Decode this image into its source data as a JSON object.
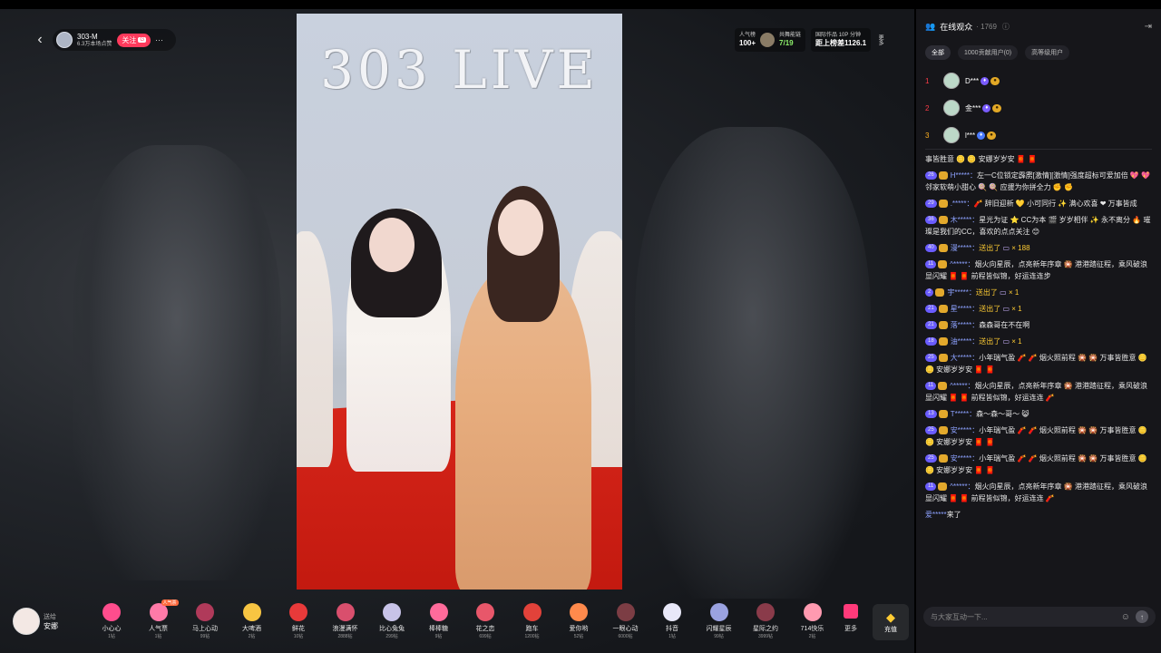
{
  "anchor": {
    "name": "303-M",
    "sub": "6.3万本场点赞",
    "follow": "关注",
    "follow_badge": "G",
    "more": "···"
  },
  "top_stats": {
    "popularity_label": "人气榜",
    "popularity_val": "100+",
    "rank_label": "共舞能链",
    "rank_val": "7/19",
    "hour_label": "国际作品 10P 分钟",
    "hour_val": "距上榜差1126.1",
    "side_label": "更多"
  },
  "video": {
    "logo": "303 LIVE"
  },
  "gift_user": {
    "to": "送给",
    "name": "安娜"
  },
  "gifts": [
    {
      "name": "小心心",
      "price": "1钻",
      "color": "#ff4d8d"
    },
    {
      "name": "人气票",
      "price": "1钻",
      "color": "#ff7aa8",
      "tag": "人气票"
    },
    {
      "name": "马上心动",
      "price": "99钻",
      "color": "#b03a5a"
    },
    {
      "name": "大啤酒",
      "price": "2钻",
      "color": "#f7c542"
    },
    {
      "name": "鲜花",
      "price": "10钻",
      "color": "#e83a3a"
    },
    {
      "name": "浪漫满怀",
      "price": "2888钻",
      "color": "#d94f6d"
    },
    {
      "name": "比心兔兔",
      "price": "299钻",
      "color": "#c8c3e8"
    },
    {
      "name": "棒棒糖",
      "price": "9钻",
      "color": "#ff6b9b"
    },
    {
      "name": "花之恋",
      "price": "699钻",
      "color": "#e8576a"
    },
    {
      "name": "跑车",
      "price": "1200钻",
      "color": "#e2423a"
    },
    {
      "name": "爱你哟",
      "price": "52钻",
      "color": "#ff8a4c"
    },
    {
      "name": "一眼心动",
      "price": "6000钻",
      "color": "#7c3d44"
    },
    {
      "name": "抖音",
      "price": "1钻",
      "color": "#e8e8f8"
    },
    {
      "name": "闪耀星辰",
      "price": "99钻",
      "color": "#9aa2e0"
    },
    {
      "name": "星际之约",
      "price": "3999钻",
      "color": "#8a3b4a"
    },
    {
      "name": "714快乐",
      "price": "2钻",
      "color": "#ff9ab0"
    }
  ],
  "gift_more": "更多",
  "recharge": "充值",
  "panel": {
    "title": "在线观众",
    "count": "· 1769",
    "info": "ⓘ",
    "collapse": "⇥",
    "tabs": [
      "全部",
      "1000贡献用户(0)",
      "高等级用户"
    ],
    "ranks": [
      {
        "num": "1",
        "name": "D***"
      },
      {
        "num": "2",
        "name": "金***"
      },
      {
        "num": "3",
        "name": "l***"
      }
    ],
    "messages": [
      {
        "lv": "",
        "user": "",
        "text": "事皆胜意 🪙 🪙 安娜岁岁安 🧧 🧧"
      },
      {
        "lv": "26",
        "user": "H*****：",
        "text": "左一C位锁定霹雳[激情][激情]强度超标可爱加倍 💖 💖 邻家软萌小甜心 🍭 🍭 应援为你拼全力 ✊ ✊"
      },
      {
        "lv": "29",
        "user": ".*****：",
        "text": "🧨 辞旧迎新 💛 小可同行 ✨ 满心欢喜 ❤ 万事皆成"
      },
      {
        "lv": "36",
        "user": "木*****：",
        "text": "星光为证 ⭐ CC为本 🎬 岁岁相伴 ✨ 永不离分 🔥 璀璨是我们的CC，喜欢的点点关注 😊"
      },
      {
        "lv": "40",
        "user": "漫*****：",
        "gift": "送出了",
        "text": "",
        "count": "× 188"
      },
      {
        "lv": "11",
        "user": "^*****：",
        "text": "烟火向星辰，点亮新年序章 🎇 港港踏征程，乘风破浪显闪耀 🧧 🧧 前程皆似锦，好运连连步"
      },
      {
        "lv": "2",
        "user": "宇*****：",
        "gift": "送出了",
        "text": "",
        "count": "× 1"
      },
      {
        "lv": "21",
        "user": "星*****：",
        "gift": "送出了",
        "text": "",
        "count": "× 1"
      },
      {
        "lv": "21",
        "user": "落*****：",
        "text": "森森哥在不在啊"
      },
      {
        "lv": "18",
        "user": "油*****：",
        "gift": "送出了",
        "text": "",
        "count": "× 1"
      },
      {
        "lv": "25",
        "user": "大*****：",
        "text": "小年瑞气盈 🧨 🧨 烟火照前程 🎇 🎇 万事皆胜意 🪙 🪙 安娜岁岁安 🧧 🧧"
      },
      {
        "lv": "11",
        "user": "^*****：",
        "text": "烟火向星辰，点亮新年序章 🎇 港港踏征程，乘风破浪显闪耀 🧧 🧧 前程皆似锦，好运连连 🧨"
      },
      {
        "lv": "13",
        "user": "T*****：",
        "text": "森～森～哥～ 😸"
      },
      {
        "lv": "25",
        "user": "安*****：",
        "text": "小年瑞气盈 🧨 🧨 烟火照前程 🎇 🎇 万事皆胜意 🪙 🪙 安娜岁岁安 🧧 🧧"
      },
      {
        "lv": "25",
        "user": "安*****：",
        "text": "小年瑞气盈 🧨 🧨 烟火照前程 🎇 🎇 万事皆胜意 🪙 🪙 安娜岁岁安 🧧 🧧"
      },
      {
        "lv": "11",
        "user": "^*****：",
        "text": "烟火向星辰，点亮新年序章 🎇 港港踏征程，乘风破浪显闪耀 🧧 🧧 前程皆似锦，好运连连 🧨"
      },
      {
        "lv": "",
        "user": "爱*****",
        "text": "来了"
      }
    ],
    "input_placeholder": "与大家互动一下...",
    "emoji_icon": "☺",
    "send_icon": "↑"
  }
}
